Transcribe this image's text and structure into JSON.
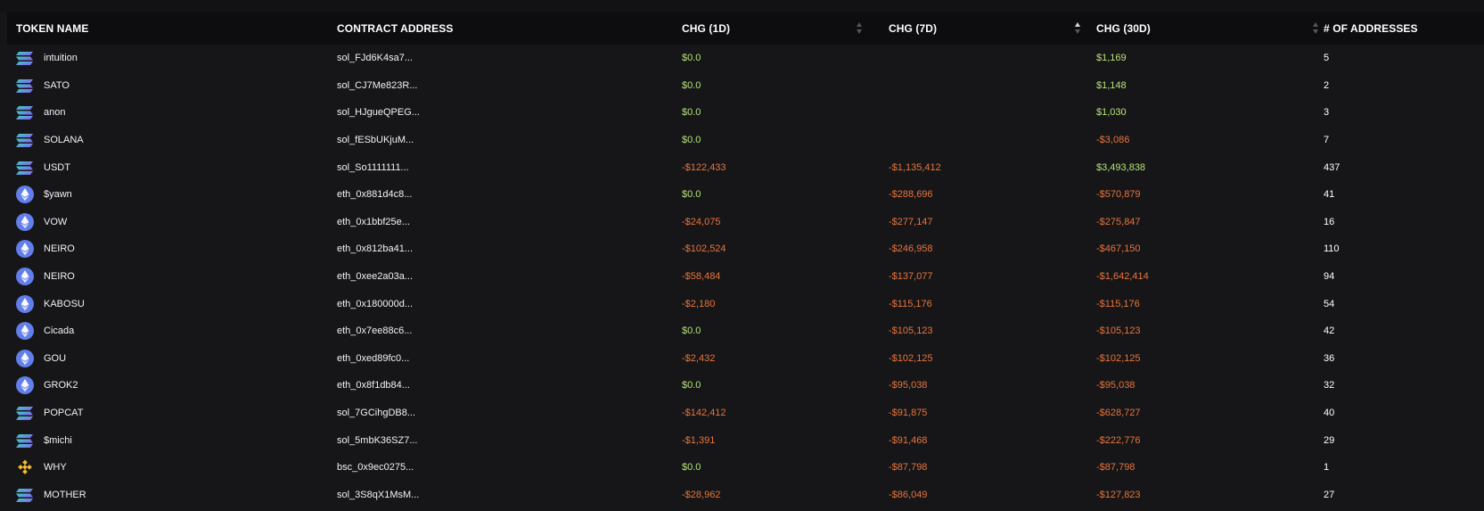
{
  "header": {
    "token_name": "TOKEN NAME",
    "contract_address": "CONTRACT ADDRESS",
    "chg_1d": "CHG (1D)",
    "chg_7d": "CHG (7D)",
    "chg_30d": "CHG (30D)",
    "num_addresses": "# OF ADDRESSES"
  },
  "colors": {
    "positive": "#b6e37a",
    "negative": "#e8743c",
    "header_bg": "#0d0d0f",
    "row_bg": "#161618"
  },
  "rows": [
    {
      "chain": "sol",
      "name": "intuition",
      "address": "sol_FJd6K4sa7...",
      "d1": "$0.0",
      "d7": "",
      "d30": "$1,169",
      "count": "5"
    },
    {
      "chain": "sol",
      "name": "SATO",
      "address": "sol_CJ7Me823R...",
      "d1": "$0.0",
      "d7": "",
      "d30": "$1,148",
      "count": "2"
    },
    {
      "chain": "sol",
      "name": "anon",
      "address": "sol_HJgueQPEG...",
      "d1": "$0.0",
      "d7": "",
      "d30": "$1,030",
      "count": "3"
    },
    {
      "chain": "sol",
      "name": "SOLANA",
      "address": "sol_fESbUKjuM...",
      "d1": "$0.0",
      "d7": "",
      "d30": "-$3,086",
      "count": "7"
    },
    {
      "chain": "sol",
      "name": "USDT",
      "address": "sol_So1111111...",
      "d1": "-$122,433",
      "d7": "-$1,135,412",
      "d30": "$3,493,838",
      "count": "437"
    },
    {
      "chain": "eth",
      "name": "$yawn",
      "address": "eth_0x881d4c8...",
      "d1": "$0.0",
      "d7": "-$288,696",
      "d30": "-$570,879",
      "count": "41"
    },
    {
      "chain": "eth",
      "name": "VOW",
      "address": "eth_0x1bbf25e...",
      "d1": "-$24,075",
      "d7": "-$277,147",
      "d30": "-$275,847",
      "count": "16"
    },
    {
      "chain": "eth",
      "name": "NEIRO",
      "address": "eth_0x812ba41...",
      "d1": "-$102,524",
      "d7": "-$246,958",
      "d30": "-$467,150",
      "count": "110"
    },
    {
      "chain": "eth",
      "name": "NEIRO",
      "address": "eth_0xee2a03a...",
      "d1": "-$58,484",
      "d7": "-$137,077",
      "d30": "-$1,642,414",
      "count": "94"
    },
    {
      "chain": "eth",
      "name": "KABOSU",
      "address": "eth_0x180000d...",
      "d1": "-$2,180",
      "d7": "-$115,176",
      "d30": "-$115,176",
      "count": "54"
    },
    {
      "chain": "eth",
      "name": "Cicada",
      "address": "eth_0x7ee88c6...",
      "d1": "$0.0",
      "d7": "-$105,123",
      "d30": "-$105,123",
      "count": "42"
    },
    {
      "chain": "eth",
      "name": "GOU",
      "address": "eth_0xed89fc0...",
      "d1": "-$2,432",
      "d7": "-$102,125",
      "d30": "-$102,125",
      "count": "36"
    },
    {
      "chain": "eth",
      "name": "GROK2",
      "address": "eth_0x8f1db84...",
      "d1": "$0.0",
      "d7": "-$95,038",
      "d30": "-$95,038",
      "count": "32"
    },
    {
      "chain": "sol",
      "name": "POPCAT",
      "address": "sol_7GCihgDB8...",
      "d1": "-$142,412",
      "d7": "-$91,875",
      "d30": "-$628,727",
      "count": "40"
    },
    {
      "chain": "sol",
      "name": "$michi",
      "address": "sol_5mbK36SZ7...",
      "d1": "-$1,391",
      "d7": "-$91,468",
      "d30": "-$222,776",
      "count": "29"
    },
    {
      "chain": "bsc",
      "name": "WHY",
      "address": "bsc_0x9ec0275...",
      "d1": "$0.0",
      "d7": "-$87,798",
      "d30": "-$87,798",
      "count": "1"
    },
    {
      "chain": "sol",
      "name": "MOTHER",
      "address": "sol_3S8qX1MsM...",
      "d1": "-$28,962",
      "d7": "-$86,049",
      "d30": "-$127,823",
      "count": "27"
    }
  ]
}
